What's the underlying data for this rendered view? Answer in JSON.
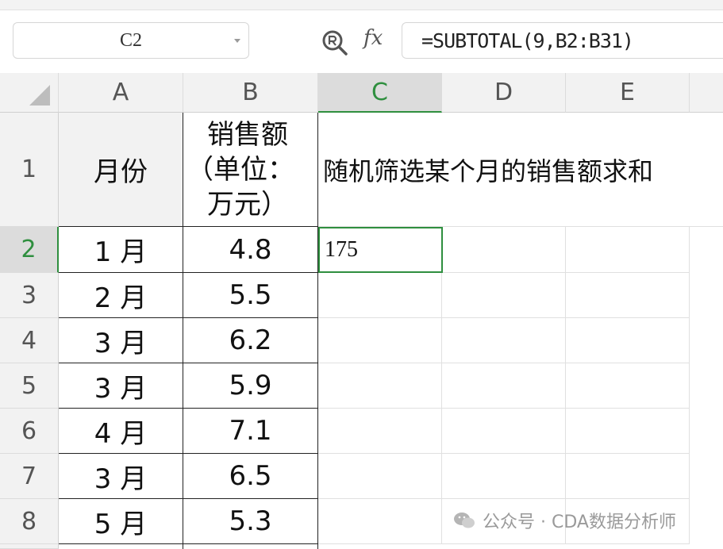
{
  "name_box": "C2",
  "formula": "=SUBTOTAL(9,B2:B31)",
  "columns": [
    "A",
    "B",
    "C",
    "D",
    "E"
  ],
  "rows": [
    "1",
    "2",
    "3",
    "4",
    "5",
    "6",
    "7",
    "8"
  ],
  "header_row": {
    "a": "月份",
    "b_lines": [
      "销售额",
      "（单位：",
      "万元）"
    ],
    "c": "随机筛选某个月的销售额求和"
  },
  "result": "175",
  "data": [
    {
      "month": "1 月",
      "sales": "4.8"
    },
    {
      "month": "2 月",
      "sales": "5.5"
    },
    {
      "month": "3 月",
      "sales": "6.2"
    },
    {
      "month": "3 月",
      "sales": "5.9"
    },
    {
      "month": "4 月",
      "sales": "7.1"
    },
    {
      "month": "3 月",
      "sales": "6.5"
    },
    {
      "month": "5 月",
      "sales": "5.3"
    }
  ],
  "watermark": "公众号 · CDA数据分析师",
  "colors": {
    "selection": "#2f8f3f"
  }
}
